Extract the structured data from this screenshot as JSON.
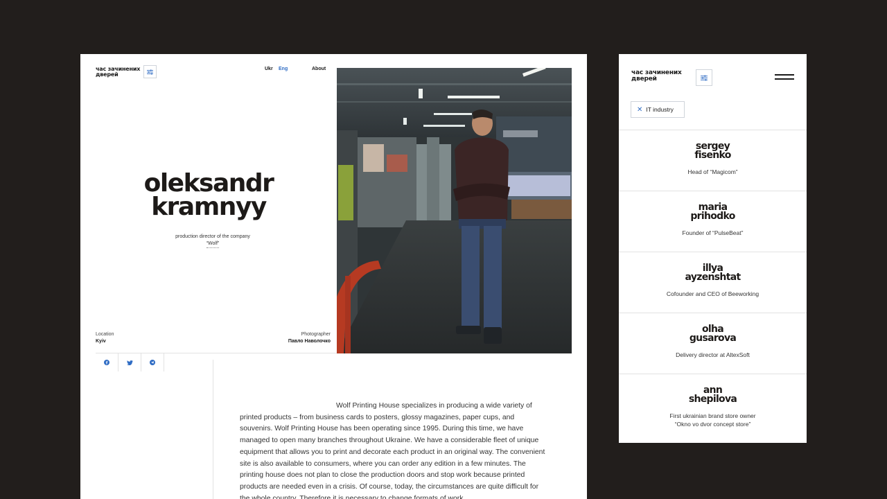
{
  "desktop": {
    "logo_line1": "час зачинених",
    "logo_line2": "дверей",
    "nav": {
      "ukr": "Ukr",
      "eng": "Eng",
      "about": "About"
    },
    "hero": {
      "first_name": "oleksandr",
      "last_name": "kramnyy",
      "role_line1": "production director of the company",
      "company": "“Wolf”"
    },
    "location": {
      "label": "Location",
      "value": "Kyiv"
    },
    "photographer": {
      "label": "Photographer",
      "value": "Павло Наволочко"
    },
    "socials": [
      "facebook-icon",
      "twitter-icon",
      "telegram-icon"
    ],
    "article": "Wolf Printing House specializes in producing a wide variety of printed products – from business cards to posters, glossy magazines, paper cups, and souvenirs. Wolf Printing House has been operating since 1995. During this time, we have managed to open many branches throughout Ukraine. We have a considerable fleet of unique equipment that allows you to print and decorate each product in an original way. The convenient site is also available to consumers, where you can order any edition in a few minutes. The printing house does not plan to close the production doors and stop work because printed products are needed even in a crisis. Of course, today, the circumstances are quite difficult for the whole country. Therefore it is necessary to change formats of work."
  },
  "mobile": {
    "logo_line1": "час зачинених",
    "logo_line2": "дверей",
    "filter_chip": "IT industry",
    "people": [
      {
        "first": "sergey",
        "last": "fisenko",
        "role1": "Head of “Magicom”",
        "role2": ""
      },
      {
        "first": "maria",
        "last": "prihodko",
        "role1": "Founder of “PulseBeat”",
        "role2": ""
      },
      {
        "first": "illya",
        "last": "ayzenshtat",
        "role1": "Cofounder and CEO of Beeworking",
        "role2": ""
      },
      {
        "first": "olha",
        "last": "gusarova",
        "role1": "Delivery director at AltexSoft",
        "role2": ""
      },
      {
        "first": "ann",
        "last": "shepilova",
        "role1": "First ukrainian brand store owner",
        "role2": "“Okno vo dvor concept store”"
      }
    ]
  },
  "colors": {
    "background": "#221e1c",
    "accent": "#2f6cc4",
    "card": "#ffffff"
  }
}
